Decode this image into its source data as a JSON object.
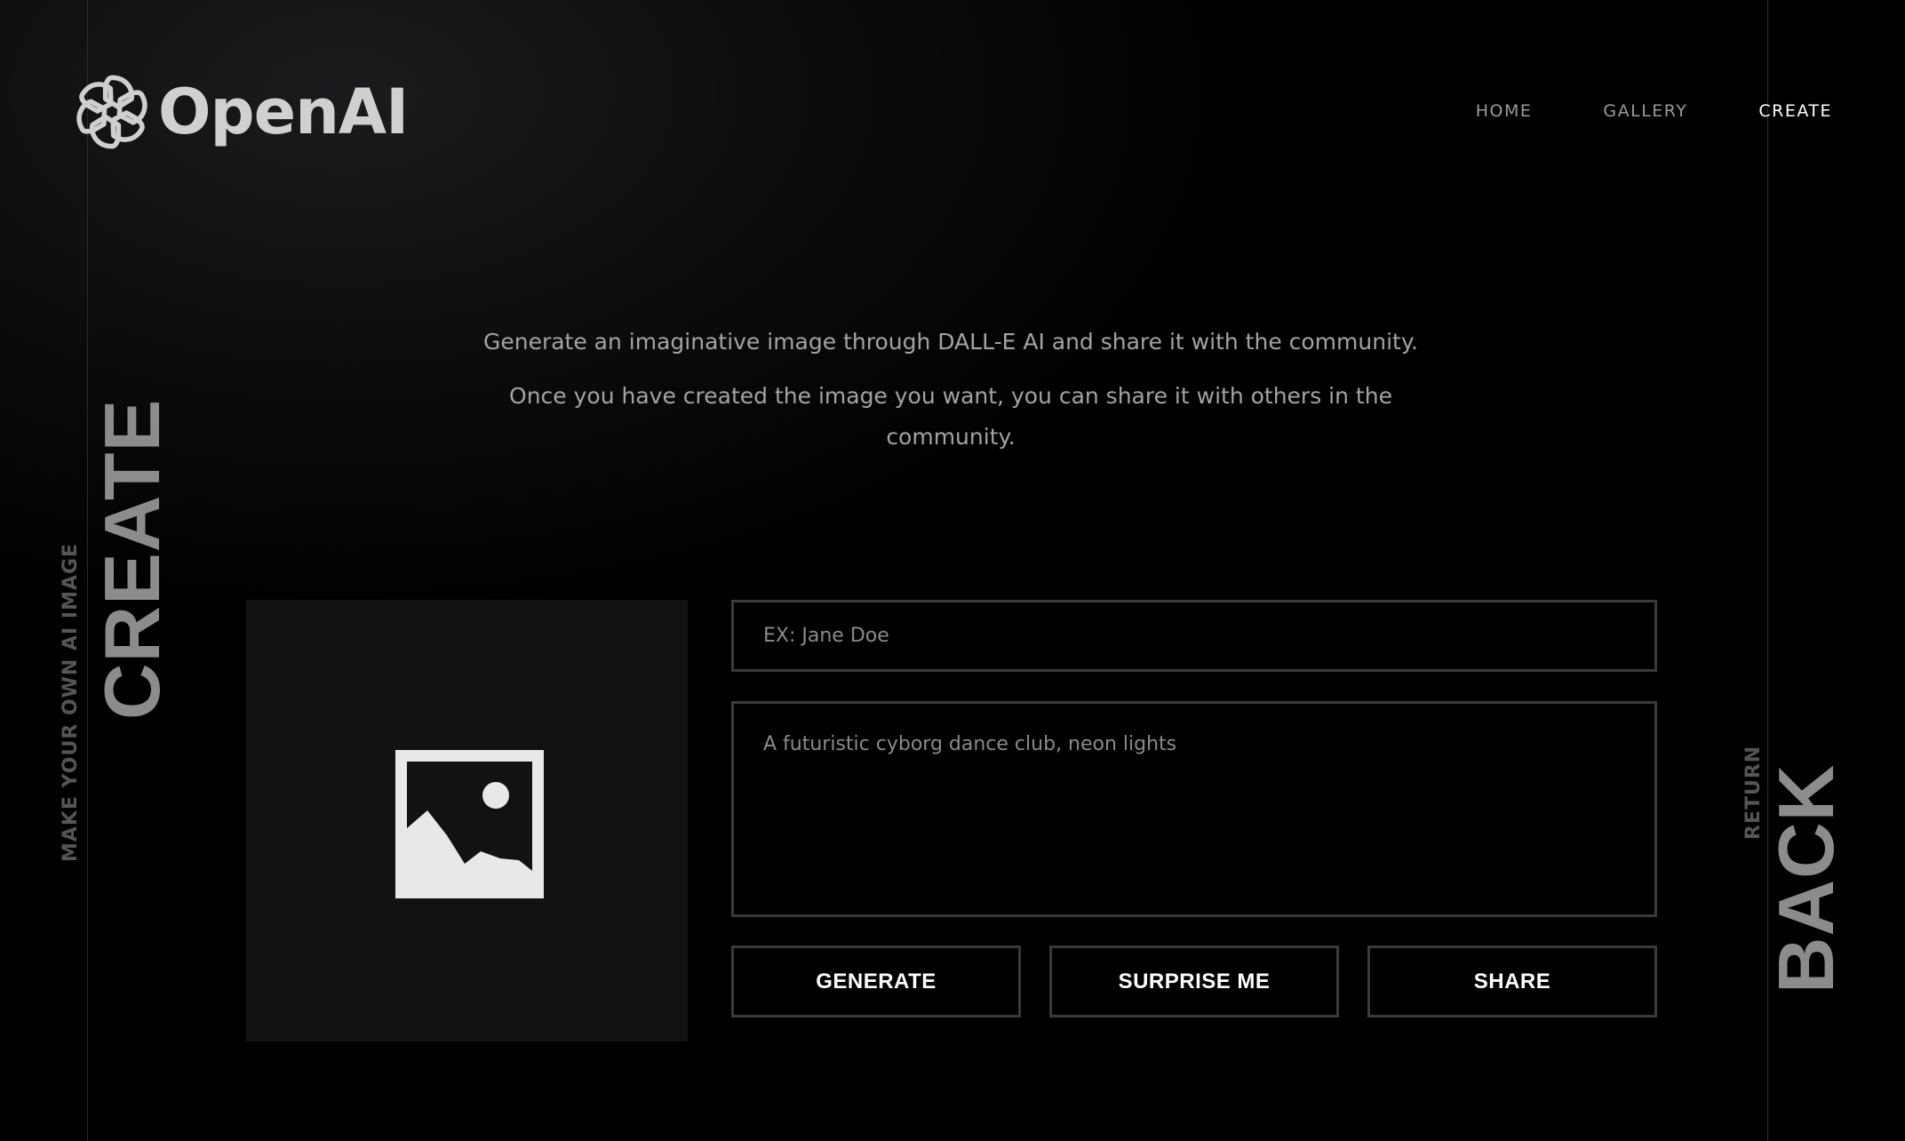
{
  "brand": {
    "name": "OpenAI",
    "logo_icon": "openai-logo-icon"
  },
  "nav": {
    "items": [
      {
        "label": "HOME"
      },
      {
        "label": "GALLERY"
      },
      {
        "label": "CREATE"
      }
    ],
    "active": "CREATE"
  },
  "intro": {
    "line1": "Generate an imaginative image through DALL-E AI and share it with the community.",
    "line2": "Once you have created the image you want, you can share it with others in the community."
  },
  "side_left": {
    "title": "CREATE",
    "subtitle": "MAKE YOUR OWN AI IMAGE"
  },
  "side_right": {
    "title": "BACK",
    "subtitle": "RETURN"
  },
  "preview": {
    "icon": "image-placeholder-icon"
  },
  "form": {
    "name_placeholder": "EX: Jane Doe",
    "name_value": "",
    "prompt_placeholder": "A futuristic cyborg dance club, neon lights",
    "prompt_value": ""
  },
  "buttons": {
    "generate": "GENERATE",
    "surprise": "SURPRISE ME",
    "share": "SHARE"
  },
  "colors": {
    "background": "#000000",
    "border": "#3a3a3a",
    "text_muted": "#a3a3a3",
    "active_nav": "#ffffff"
  }
}
